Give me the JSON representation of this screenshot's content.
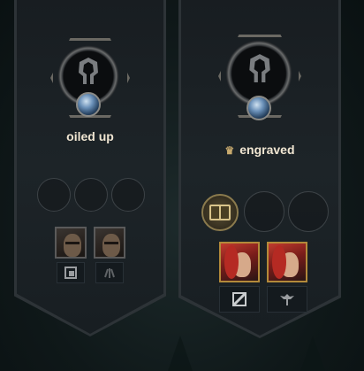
{
  "banners": [
    {
      "title": "oiled up",
      "has_crown": false,
      "emblem_icon": "helmet-icon",
      "skill_slots": [
        "empty",
        "empty",
        "empty"
      ],
      "cosmetics": [
        {
          "portrait": "dark-champion-portrait",
          "tag_icon": "square-target-icon"
        },
        {
          "portrait": "dark-champion-portrait",
          "tag_icon": "claw-icon"
        }
      ]
    },
    {
      "title": "engraved",
      "has_crown": true,
      "crown_icon": "crown-icon",
      "emblem_icon": "helmet-icon",
      "skill_slots": [
        "book-emblem",
        "empty",
        "empty"
      ],
      "cosmetics": [
        {
          "portrait": "red-haired-champion-portrait",
          "tag_icon": "slash-box-icon"
        },
        {
          "portrait": "red-haired-champion-portrait",
          "tag_icon": "winged-emblem-icon"
        }
      ]
    }
  ]
}
